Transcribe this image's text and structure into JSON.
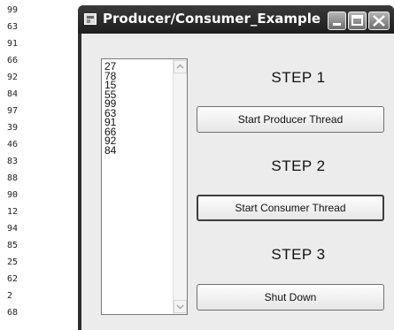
{
  "console": {
    "lines": [
      "99",
      "63",
      "91",
      "66",
      "92",
      "84",
      "97",
      "39",
      "46",
      "83",
      "88",
      "90",
      "12",
      "94",
      "85",
      "25",
      "62",
      "2",
      "68"
    ]
  },
  "window": {
    "title": "Producer/Consumer_Example",
    "icons": {
      "app": "app-form-icon",
      "minimize": "minimize-icon",
      "maximize": "maximize-icon",
      "close": "close-icon"
    }
  },
  "listbox": {
    "items": [
      "27",
      "78",
      "15",
      "55",
      "99",
      "63",
      "91",
      "66",
      "92",
      "84"
    ]
  },
  "steps": [
    {
      "heading": "STEP 1",
      "button": "Start Producer Thread"
    },
    {
      "heading": "STEP 2",
      "button": "Start Consumer Thread"
    },
    {
      "heading": "STEP 3",
      "button": "Shut Down"
    }
  ]
}
